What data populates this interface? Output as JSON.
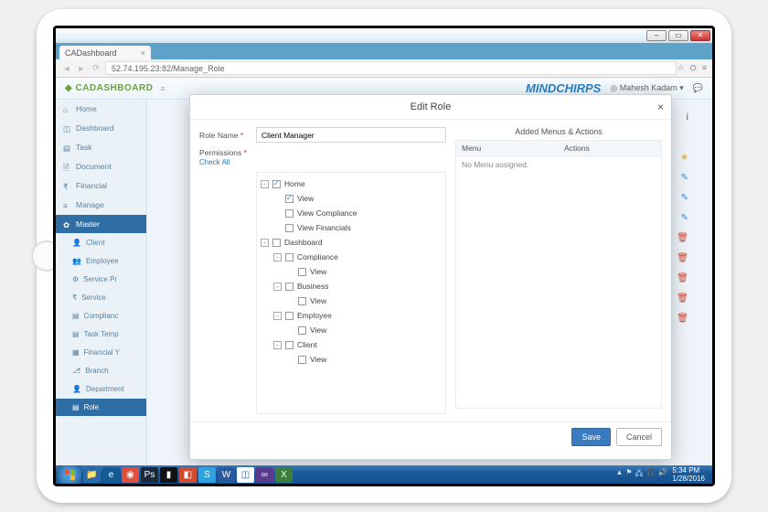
{
  "window": {
    "tab_title": "CADashboard",
    "url": "52.74.195.23:82/Manage_Role"
  },
  "header": {
    "brand": "CADASHBOARD",
    "partner": "MINDCHIRPS",
    "user_name": "Mahesh Kadam"
  },
  "sidebar": {
    "items": [
      {
        "icon": "home",
        "label": "Home"
      },
      {
        "icon": "dashboard",
        "label": "Dashboard"
      },
      {
        "icon": "task",
        "label": "Task"
      },
      {
        "icon": "document",
        "label": "Document"
      },
      {
        "icon": "financial",
        "label": "Financial"
      },
      {
        "icon": "manage",
        "label": "Manage"
      },
      {
        "icon": "master",
        "label": "Master",
        "active": true
      }
    ],
    "subitems": [
      {
        "label": "Client"
      },
      {
        "label": "Employee"
      },
      {
        "label": "Service Pr"
      },
      {
        "label": "Service"
      },
      {
        "label": "Complianc"
      },
      {
        "label": "Task Temp"
      },
      {
        "label": "Financial Y"
      },
      {
        "label": "Branch"
      },
      {
        "label": "Department"
      },
      {
        "label": "Role",
        "active": true
      }
    ]
  },
  "modal": {
    "title": "Edit Role",
    "role_name_label": "Role Name",
    "role_name_value": "Client Manager",
    "permissions_label": "Permissions",
    "check_all": "Check All",
    "tree": [
      {
        "level": 0,
        "expand": "-",
        "checked": true,
        "label": "Home",
        "partial": true
      },
      {
        "level": 1,
        "expand": "",
        "checked": true,
        "label": "View"
      },
      {
        "level": 1,
        "expand": "",
        "checked": false,
        "label": "View Compliance"
      },
      {
        "level": 1,
        "expand": "",
        "checked": false,
        "label": "View Financials"
      },
      {
        "level": 0,
        "expand": "-",
        "checked": false,
        "label": "Dashboard"
      },
      {
        "level": 1,
        "expand": "-",
        "checked": false,
        "label": "Compliance"
      },
      {
        "level": 2,
        "expand": "",
        "checked": false,
        "label": "View"
      },
      {
        "level": 1,
        "expand": "-",
        "checked": false,
        "label": "Business"
      },
      {
        "level": 2,
        "expand": "",
        "checked": false,
        "label": "View"
      },
      {
        "level": 1,
        "expand": "-",
        "checked": false,
        "label": "Employee"
      },
      {
        "level": 2,
        "expand": "",
        "checked": false,
        "label": "View"
      },
      {
        "level": 1,
        "expand": "-",
        "checked": false,
        "label": "Client"
      },
      {
        "level": 2,
        "expand": "",
        "checked": false,
        "label": "View"
      }
    ],
    "right_title": "Added Menus & Actions",
    "col_menu": "Menu",
    "col_actions": "Actions",
    "empty_msg": "No Menu assigned.",
    "save": "Save",
    "cancel": "Cancel"
  },
  "taskbar": {
    "time": "5:34 PM",
    "date": "1/28/2016"
  }
}
